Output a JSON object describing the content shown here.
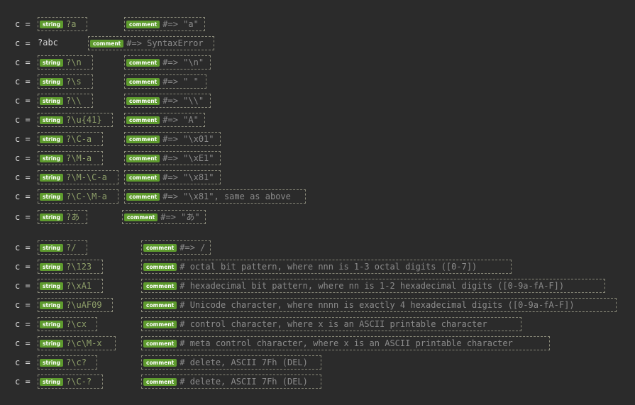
{
  "lhs_prefix": "c = ",
  "badges": {
    "string": "string",
    "comment": "comment"
  },
  "rows": [
    {
      "string": "?a",
      "comment": "#=> \"a\""
    },
    {
      "literal": "?abc",
      "comment": "#=> SyntaxError"
    },
    {
      "string": "?\\n",
      "comment": "#=> \"\\n\""
    },
    {
      "string": "?\\s",
      "comment": "#=> \" \""
    },
    {
      "string": "?\\\\",
      "comment": "#=> \"\\\\\""
    },
    {
      "string": "?\\u{41}",
      "comment": "#=> \"A\""
    },
    {
      "string": "?\\C-a",
      "comment": "#=> \"\\x01\""
    },
    {
      "string": "?\\M-a",
      "comment": "#=> \"\\xE1\""
    },
    {
      "string": "?\\M-\\C-a",
      "comment": "#=> \"\\x81\""
    },
    {
      "string": "?\\C-\\M-a",
      "comment": "#=> \"\\x81\", same as above"
    },
    {
      "string": "?あ",
      "comment": "#=> \"あ\""
    },
    {
      "string": "?/",
      "comment": "#=> /"
    },
    {
      "string": "?\\123",
      "comment": "# octal bit pattern, where nnn is 1-3 octal digits ([0-7])"
    },
    {
      "string": "?\\xA1",
      "comment": "# hexadecimal bit pattern, where nn is 1-2 hexadecimal digits ([0-9a-fA-F])"
    },
    {
      "string": "?\\uAF09",
      "comment": "# Unicode character, where nnnn is exactly 4 hexadecimal digits ([0-9a-fA-F])"
    },
    {
      "string": "?\\cx",
      "comment": "# control character, where x is an ASCII printable character"
    },
    {
      "string": "?\\c\\M-x",
      "comment": "# meta control character, where x is an ASCII printable character"
    },
    {
      "string": "?\\c?",
      "comment": "# delete, ASCII 7Fh (DEL)"
    },
    {
      "string": "?\\C-?",
      "comment": "# delete, ASCII 7Fh (DEL)"
    }
  ]
}
